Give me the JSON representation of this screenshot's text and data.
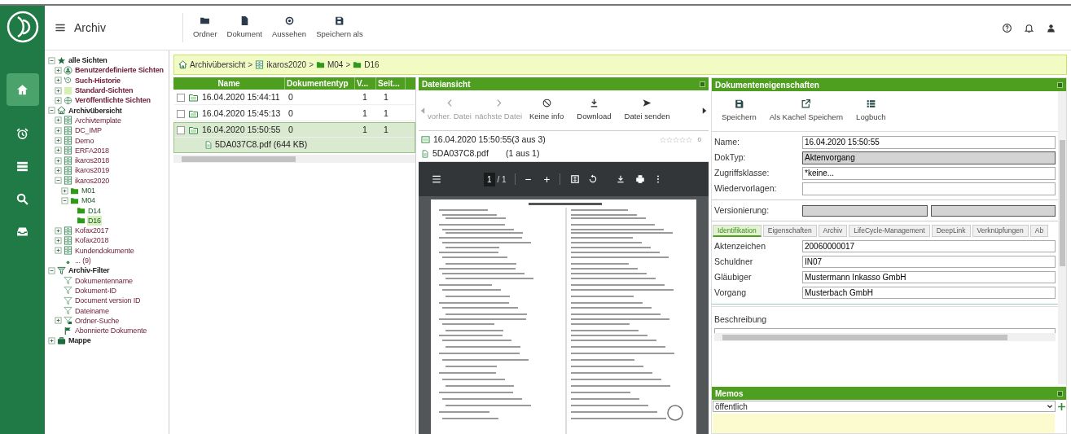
{
  "app": {
    "title": "Archiv"
  },
  "rail": [
    {
      "kind": "home",
      "selected": true
    },
    {
      "kind": "alarm",
      "selected": false
    },
    {
      "kind": "list",
      "selected": false
    },
    {
      "kind": "search",
      "selected": false
    },
    {
      "kind": "inbox",
      "selected": false
    }
  ],
  "toolbar": [
    {
      "kind": "folder",
      "label": "Ordner"
    },
    {
      "kind": "document",
      "label": "Dokument"
    },
    {
      "kind": "eye",
      "label": "Aussehen"
    },
    {
      "kind": "save",
      "label": "Speichern als"
    }
  ],
  "tree": [
    {
      "kind": "views",
      "label": "alle Sichten",
      "expanded": true,
      "selected": false,
      "children": [
        {
          "kind": "custom-views",
          "label": "Benutzerdefinierte Sichten",
          "expanded": false,
          "selected": false
        },
        {
          "kind": "history",
          "label": "Such-Historie",
          "expanded": false,
          "selected": false
        },
        {
          "kind": "standard-views",
          "label": "Standard-Sichten",
          "expanded": false,
          "selected": false
        },
        {
          "kind": "published-views",
          "label": "Veröffentlichte Sichten",
          "expanded": false,
          "selected": false
        }
      ]
    },
    {
      "kind": "archives",
      "label": "Archivübersicht",
      "expanded": true,
      "selected": false,
      "children": [
        {
          "kind": "archive",
          "label": "Archivtemplate",
          "expanded": false,
          "selected": false
        },
        {
          "kind": "archive",
          "label": "DC_IMP",
          "expanded": false,
          "selected": false
        },
        {
          "kind": "archive",
          "label": "Demo",
          "expanded": false,
          "selected": false
        },
        {
          "kind": "archive",
          "label": "ERFA2018",
          "expanded": false,
          "selected": false
        },
        {
          "kind": "archive",
          "label": "ikaros2018",
          "expanded": false,
          "selected": false
        },
        {
          "kind": "archive",
          "label": "ikaros2019",
          "expanded": false,
          "selected": false
        },
        {
          "kind": "archive",
          "label": "ikaros2020",
          "expanded": true,
          "selected": false,
          "children": [
            {
              "kind": "folder",
              "label": "M01",
              "expanded": false,
              "selected": false
            },
            {
              "kind": "folder",
              "label": "M04",
              "expanded": true,
              "selected": false,
              "children": [
                {
                  "kind": "folder",
                  "label": "D14",
                  "selected": false
                },
                {
                  "kind": "folder",
                  "label": "D16",
                  "selected": true
                }
              ]
            }
          ]
        },
        {
          "kind": "archive",
          "label": "Kofax2017",
          "expanded": false,
          "selected": false
        },
        {
          "kind": "archive",
          "label": "Kofax2018",
          "expanded": false,
          "selected": false
        },
        {
          "kind": "archive",
          "label": "Kundendokumente",
          "expanded": false,
          "selected": false
        },
        {
          "kind": "more",
          "label": "... (9)",
          "selected": false
        }
      ]
    },
    {
      "kind": "filters",
      "label": "Archiv-Filter",
      "expanded": true,
      "selected": false,
      "children": [
        {
          "kind": "filter",
          "label": "Dokumentenname",
          "selected": false
        },
        {
          "kind": "filter",
          "label": "Dokument-ID",
          "selected": false
        },
        {
          "kind": "filter",
          "label": "Document version ID",
          "selected": false
        },
        {
          "kind": "filter",
          "label": "Dateiname",
          "selected": false
        },
        {
          "kind": "folder-search",
          "label": "Ordner-Suche",
          "expanded": false,
          "selected": false
        },
        {
          "kind": "subscribed",
          "label": "Abonnierte Dokumente",
          "selected": false
        }
      ]
    },
    {
      "kind": "case",
      "label": "Mappe",
      "expanded": false,
      "selected": false
    }
  ],
  "breadcrumb": [
    {
      "kind": "home",
      "label": "Archivübersicht"
    },
    {
      "kind": "archive",
      "label": "ikaros2020",
      "separator": ">"
    },
    {
      "kind": "folder",
      "label": "M04",
      "separator": ">"
    },
    {
      "kind": "folder",
      "label": "D16",
      "separator": ">"
    }
  ],
  "file_list": {
    "columns": [
      "Name",
      "Dokumententyp",
      "V...",
      "Seit..."
    ],
    "rows": [
      {
        "checked": false,
        "selected": false,
        "cells": [
          "16.04.2020 15:44:11",
          "0",
          "1",
          "1"
        ]
      },
      {
        "checked": false,
        "selected": false,
        "cells": [
          "16.04.2020 15:45:13",
          "0",
          "1",
          "1"
        ]
      },
      {
        "checked": false,
        "selected": true,
        "cells": [
          "16.04.2020 15:50:55",
          "0",
          "1",
          "1"
        ],
        "files": [
          "5DA037C8.pdf (644 KB)"
        ]
      }
    ]
  },
  "file_view": {
    "title": "Dateiansicht",
    "actions": [
      {
        "kind": "prev",
        "label": "vorher. Datei",
        "disabled": true
      },
      {
        "kind": "next",
        "label": "nächste Datei",
        "disabled": true
      },
      {
        "kind": "noinfo",
        "label": "Keine info",
        "disabled": false
      },
      {
        "kind": "download",
        "label": "Download",
        "disabled": false
      },
      {
        "kind": "send",
        "label": "Datei senden",
        "disabled": false
      }
    ],
    "document": {
      "name": "16.04.2020 15:50:55(3 aus 3)",
      "stars": 0,
      "rating": "0"
    },
    "file": {
      "name": "5DA037C8.pdf",
      "count": "(1 aus 1)"
    },
    "pdf_toolbar": {
      "page": "1",
      "pages": "/ 1"
    }
  },
  "properties": {
    "title": "Dokumenteneigenschaften",
    "actions": [
      {
        "kind": "save",
        "label": "Speichern"
      },
      {
        "kind": "tile",
        "label": "Als Kachel Speichern"
      },
      {
        "kind": "log",
        "label": "Logbuch"
      }
    ],
    "fields": [
      {
        "label": "Name:",
        "value": "16.04.2020 15:50:55",
        "disabled": false
      },
      {
        "label": "DokTyp:",
        "value": "Aktenvorgang",
        "disabled": true
      },
      {
        "label": "Zugriffsklasse:",
        "value": "*keine...",
        "disabled": false
      },
      {
        "label": "Wiedervorlagen:",
        "disabled": false
      }
    ],
    "versioning": {
      "label": "Versionierung:"
    },
    "tabs": [
      {
        "label": "Identifikation",
        "selected": true
      },
      {
        "label": "Eigenschaften",
        "selected": false
      },
      {
        "label": "Archiv",
        "selected": false
      },
      {
        "label": "LifeCycle-Management",
        "selected": false
      },
      {
        "label": "DeepLink",
        "selected": false
      },
      {
        "label": "Verknüpfungen",
        "selected": false
      },
      {
        "label": "Ab",
        "selected": false
      }
    ],
    "tab_fields": [
      {
        "label": "Aktenzeichen",
        "value": "20060000017"
      },
      {
        "label": "Schuldner",
        "value": "IN07"
      },
      {
        "label": "Gläubiger",
        "value": "Mustermann Inkasso GmbH"
      },
      {
        "label": "Vorgang",
        "value": "Musterbach GmbH"
      }
    ],
    "description": {
      "label": "Beschreibung"
    }
  },
  "memos": {
    "title": "Memos",
    "visibility": "öffentlich"
  }
}
